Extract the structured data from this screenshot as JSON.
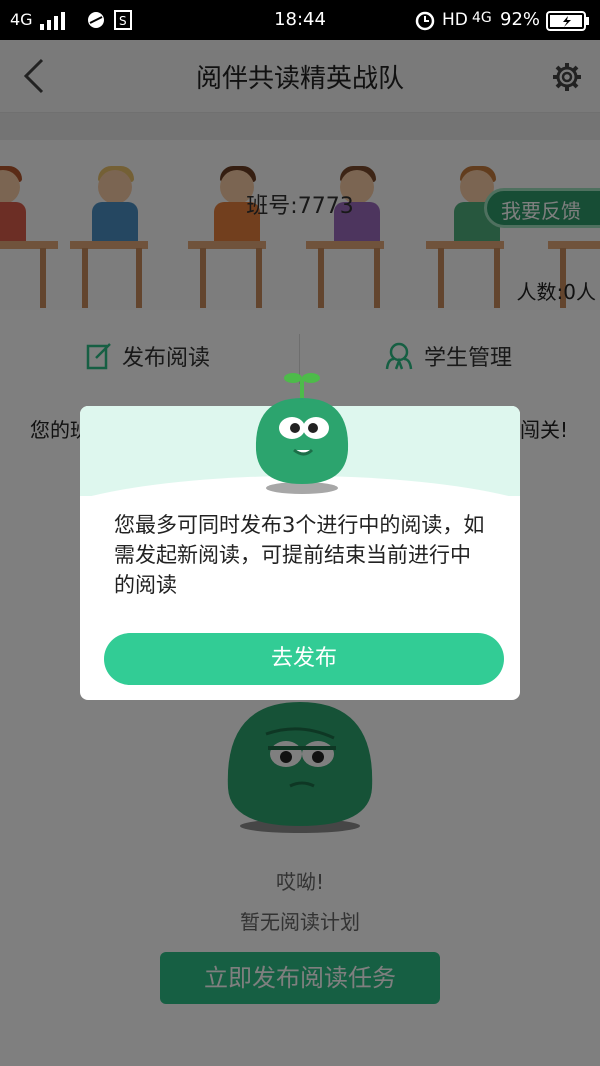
{
  "status_bar": {
    "network": "4G",
    "time": "18:44",
    "hd": "HD",
    "network2": "4G",
    "battery": "92%"
  },
  "header": {
    "title": "阅伴共读精英战队",
    "back_icon": "chevron-left-icon",
    "settings_icon": "gear-icon"
  },
  "banner": {
    "class_number": "班号:7773",
    "feedback_button": "我要反馈",
    "member_count": "人数:0人"
  },
  "actions": {
    "publish_reading": "发布阅读",
    "student_management": "学生管理"
  },
  "notice": {
    "left": "您的班",
    "right": "闯关!"
  },
  "empty_state": {
    "exclamation": "哎呦!",
    "message": "暂无阅读计划",
    "button": "立即发布阅读任务"
  },
  "dialog": {
    "message": "您最多可同时发布3个进行中的阅读，如需发起新阅读，可提前结束当前进行中的阅读",
    "button": "去发布"
  },
  "colors": {
    "accent": "#32cc95",
    "feedback_bg": "#2f9b6a",
    "dialog_header": "#def7ee"
  }
}
